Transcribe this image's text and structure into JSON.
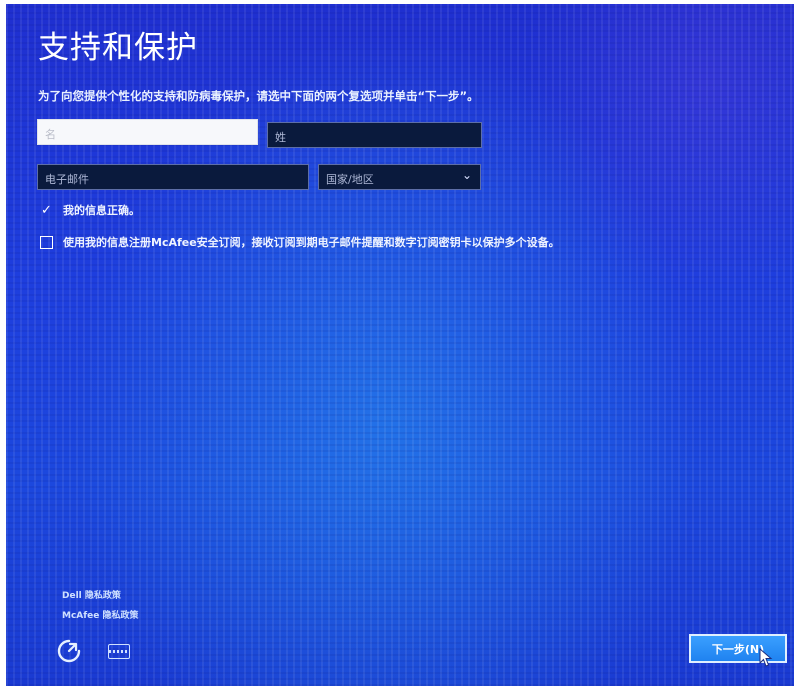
{
  "page": {
    "title": "支持和保护",
    "instruction": "为了向您提供个性化的支持和防病毒保护，请选中下面的两个复选项并单击“下一步”。"
  },
  "form": {
    "first_name_placeholder": "名",
    "last_name_placeholder": "姓",
    "email_placeholder": "电子邮件",
    "country_value": "国家/地区",
    "checkbox_info_label": "我的信息正确。",
    "checkbox_info_checked": true,
    "checkbox_mcafee_label": "使用我的信息注册McAfee安全订阅，接收订阅到期电子邮件提醒和数字订阅密钥卡以保护多个设备。",
    "checkbox_mcafee_checked": false
  },
  "footer": {
    "dell_privacy_link": "Dell 隐私政策",
    "mcafee_privacy_link": "McAfee 隐私政策",
    "next_button_label": "下一步(N)"
  },
  "icons": {
    "accessibility": "ease-of-access-icon",
    "keyboard": "keyboard-icon",
    "dropdown": "chevron-down-icon",
    "checkmark": "checkmark-icon",
    "cursor": "mouse-cursor-icon"
  },
  "colors": {
    "background": "#1e3ede",
    "dark_field": "#0a1a3d",
    "next_button": "#2a8ff6"
  }
}
